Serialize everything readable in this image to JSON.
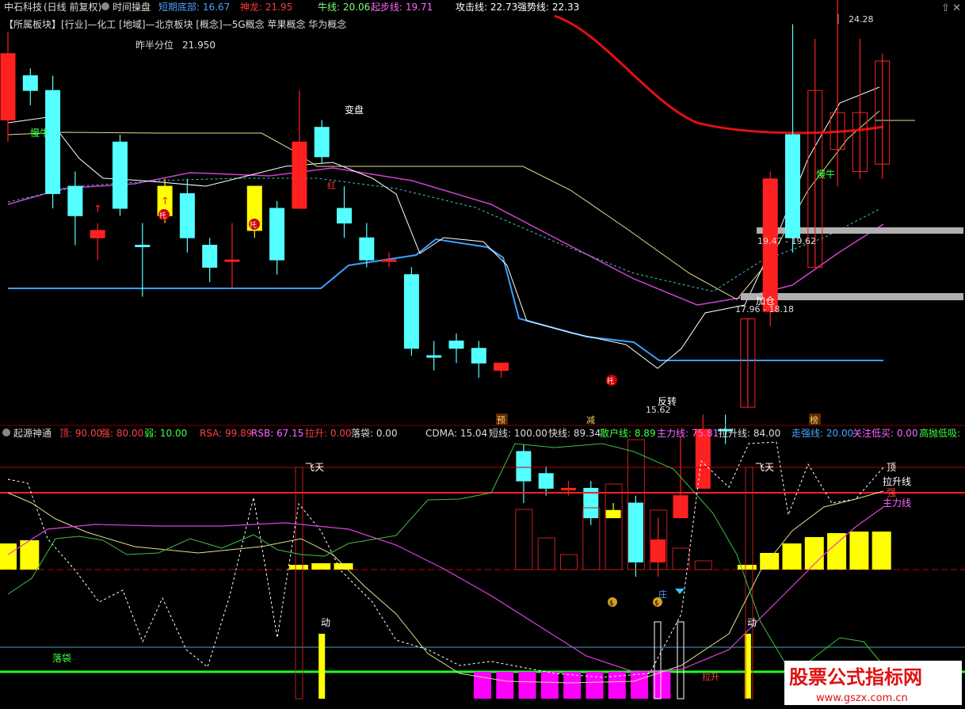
{
  "top_bar": {
    "stock": "中石科技",
    "mode": "(日线 前复权)",
    "panel_name": "时间操盘",
    "fields": [
      {
        "label": "短期底部:",
        "value": "16.67",
        "color": "#4aa3ff"
      },
      {
        "label": "神龙:",
        "value": "21.95",
        "color": "#ff3b3b"
      },
      {
        "label": "牛线:",
        "value": "20.06",
        "color": "#7fff7f"
      },
      {
        "label": "起步线:",
        "value": "19.71",
        "color": "#ff66ff"
      },
      {
        "label": "攻击线:",
        "value": "22.73",
        "color": "#ffffff"
      },
      {
        "label": "强势线:",
        "value": "22.33",
        "color": "#ffffff"
      }
    ]
  },
  "sector_line": "【所属板块】[行业]—化工 [地域]—北京板块 [概念]—5G概念 苹果概念 华为概念",
  "prev_half": {
    "label": "昨半分位",
    "value": "21.950"
  },
  "sub_bar": {
    "panel_name": "起源神通",
    "fields": [
      {
        "label": "顶:",
        "value": "90.00",
        "color": "#ff4040"
      },
      {
        "label": "强:",
        "value": "80.00",
        "color": "#ff4040"
      },
      {
        "label": "弱:",
        "value": "10.00",
        "color": "#40ff40"
      },
      {
        "label": "RSA:",
        "value": "99.89",
        "color": "#ff4040"
      },
      {
        "label": "RSB:",
        "value": "67.15",
        "color": "#ff66ff"
      },
      {
        "label": "拉升:",
        "value": "0.00",
        "color": "#ff4040"
      },
      {
        "label": "落袋:",
        "value": "0.00",
        "color": "#dddddd"
      },
      {
        "label": "CDMA:",
        "value": "15.04",
        "color": "#dddddd"
      },
      {
        "label": "短线:",
        "value": "100.00",
        "color": "#dddddd"
      },
      {
        "label": "快线:",
        "value": "89.34",
        "color": "#dddddd"
      },
      {
        "label": "散户线:",
        "value": "8.89",
        "color": "#40ff40"
      },
      {
        "label": "主力线:",
        "value": "75.81",
        "color": "#ff66ff"
      },
      {
        "label": "拉升线:",
        "value": "84.00",
        "color": "#dddddd"
      },
      {
        "label": "走强线:",
        "value": "20.00",
        "color": "#4aa3ff"
      },
      {
        "label": "关注低买:",
        "value": "0.00",
        "color": "#ff66ff"
      },
      {
        "label": "高抛低吸:",
        "value": "",
        "color": "#40ff40"
      }
    ]
  },
  "main_labels": {
    "bianpan": "变盘",
    "mangniu_left": "慢牛",
    "mangniu_right": "慢牛",
    "hong": "红",
    "fanzhuan": "反转",
    "jiacang": "加仓",
    "tuo": "托",
    "high_label": "24.28",
    "low_label": "15.62",
    "zone_upper": "19.47 - 19.62",
    "zone_lower": "17.96 - 18.18"
  },
  "marker_labels": {
    "yu": "预",
    "jian": "减",
    "bang": "榜"
  },
  "sub_labels": {
    "feitian": "飞天",
    "dong": "动",
    "luodai": "落袋",
    "lasheng": "拉升",
    "ding": "顶",
    "qiang": "强",
    "lashengxian": "拉升线",
    "zhulixian": "主力线",
    "zhuang": "庄"
  },
  "watermark": {
    "cn": "股票公式指标网",
    "url": "www.gszx.com.cn"
  },
  "colors": {
    "up": "#ff2020",
    "down": "#54ffff",
    "yellow": "#ffff00",
    "magenta": "#ff00ff",
    "grid_red": "#c00000"
  },
  "chart_data": {
    "type": "candlestick",
    "candles": [
      {
        "o": 21.2,
        "c": 22.1,
        "h": 22.4,
        "l": 20.9
      },
      {
        "o": 21.8,
        "c": 21.6,
        "h": 21.9,
        "l": 21.4
      },
      {
        "o": 21.6,
        "c": 20.2,
        "h": 21.8,
        "l": 20.0
      },
      {
        "o": 20.3,
        "c": 19.9,
        "h": 20.5,
        "l": 19.5
      },
      {
        "o": 19.7,
        "c": 19.6,
        "h": 19.8,
        "l": 19.3
      },
      {
        "o": 20.9,
        "c": 20.0,
        "h": 21.0,
        "l": 19.9
      },
      {
        "o": 19.5,
        "c": 19.5,
        "h": 19.8,
        "l": 18.8
      },
      {
        "o": 20.3,
        "c": 19.9,
        "h": 20.4,
        "l": 19.8
      },
      {
        "o": 20.2,
        "c": 19.6,
        "h": 20.4,
        "l": 19.4
      },
      {
        "o": 19.5,
        "c": 19.2,
        "h": 19.6,
        "l": 19.0
      },
      {
        "o": 19.3,
        "c": 19.3,
        "h": 19.8,
        "l": 18.9
      },
      {
        "o": 20.3,
        "c": 19.7,
        "h": 20.3,
        "l": 19.6
      },
      {
        "o": 20.0,
        "c": 19.3,
        "h": 20.1,
        "l": 19.1
      },
      {
        "o": 20.0,
        "c": 20.9,
        "h": 21.6,
        "l": 20.0
      },
      {
        "o": 21.1,
        "c": 20.7,
        "h": 21.2,
        "l": 20.6
      },
      {
        "o": 20.0,
        "c": 19.8,
        "h": 20.3,
        "l": 19.6
      },
      {
        "o": 19.6,
        "c": 19.3,
        "h": 19.8,
        "l": 19.2
      },
      {
        "o": 19.3,
        "c": 19.3,
        "h": 19.4,
        "l": 19.2
      },
      {
        "o": 19.1,
        "c": 18.1,
        "h": 19.2,
        "l": 18.0
      },
      {
        "o": 18.0,
        "c": 18.0,
        "h": 18.2,
        "l": 17.8
      },
      {
        "o": 18.2,
        "c": 18.1,
        "h": 18.3,
        "l": 17.9
      },
      {
        "o": 18.1,
        "c": 17.9,
        "h": 18.2,
        "l": 17.7
      },
      {
        "o": 17.8,
        "c": 17.9,
        "h": 17.9,
        "l": 17.7
      },
      {
        "o": 16.7,
        "c": 16.3,
        "h": 16.8,
        "l": 16.0
      },
      {
        "o": 16.4,
        "c": 16.2,
        "h": 16.5,
        "l": 16.1
      },
      {
        "o": 16.2,
        "c": 16.2,
        "h": 16.3,
        "l": 16.1
      },
      {
        "o": 16.2,
        "c": 15.8,
        "h": 16.3,
        "l": 15.7
      },
      {
        "o": 15.9,
        "c": 15.8,
        "h": 16.0,
        "l": 15.8
      },
      {
        "o": 16.0,
        "c": 15.2,
        "h": 16.1,
        "l": 15.0
      },
      {
        "o": 15.2,
        "c": 15.5,
        "h": 15.8,
        "l": 15.0
      },
      {
        "o": 15.8,
        "c": 16.1,
        "h": 16.9,
        "l": 15.8
      },
      {
        "o": 16.2,
        "c": 17.0,
        "h": 17.2,
        "l": 16.2
      },
      {
        "o": 17.0,
        "c": 17.0,
        "h": 17.2,
        "l": 16.8
      },
      {
        "o": 17.3,
        "c": 18.5,
        "h": 18.5,
        "l": 17.3
      },
      {
        "o": 18.6,
        "c": 20.4,
        "h": 20.5,
        "l": 18.4
      },
      {
        "o": 19.6,
        "c": 21.0,
        "h": 22.5,
        "l": 19.4
      },
      {
        "o": 19.2,
        "c": 21.6,
        "h": 22.3,
        "l": 19.2
      },
      {
        "o": 20.8,
        "c": 21.3,
        "h": 24.3,
        "l": 20.3
      },
      {
        "o": 20.5,
        "c": 21.3,
        "h": 22.3,
        "l": 20.4
      },
      {
        "o": 20.6,
        "c": 22.0,
        "h": 22.1,
        "l": 20.4
      }
    ],
    "candle_colors": [
      "up",
      "down",
      "down",
      "down",
      "up",
      "down",
      "flat",
      "yellow",
      "down",
      "down",
      "red-cross",
      "yellow",
      "down",
      "up",
      "down",
      "down",
      "down",
      "up",
      "down",
      "down",
      "down",
      "down",
      "up",
      "down",
      "down",
      "up",
      "down",
      "yellow",
      "down",
      "up",
      "up",
      "up",
      "flat",
      "up",
      "up",
      "down",
      "up",
      "up",
      "up",
      "up"
    ],
    "sub_yellow_bars": [
      {
        "i": 0,
        "v": 33
      },
      {
        "i": 1,
        "v": 37
      },
      {
        "i": 13,
        "v": 6
      },
      {
        "i": 14,
        "v": 8
      },
      {
        "i": 15,
        "v": 8
      },
      {
        "i": 33,
        "v": 6
      },
      {
        "i": 34,
        "v": 21
      },
      {
        "i": 35,
        "v": 33
      },
      {
        "i": 36,
        "v": 41
      },
      {
        "i": 37,
        "v": 46
      },
      {
        "i": 38,
        "v": 48
      },
      {
        "i": 39,
        "v": 48
      }
    ],
    "sub_red_bars": [
      {
        "i": 23,
        "v": 76
      },
      {
        "i": 24,
        "v": 40
      },
      {
        "i": 25,
        "v": 19
      },
      {
        "i": 26,
        "v": 78
      },
      {
        "i": 27,
        "v": 108
      },
      {
        "i": 28,
        "v": 164
      },
      {
        "i": 29,
        "v": 75
      },
      {
        "i": 30,
        "v": 27
      },
      {
        "i": 31,
        "v": 11
      }
    ],
    "sub_magenta_bars": [
      21,
      22,
      23,
      24,
      25,
      26,
      27,
      28,
      29
    ],
    "sub_dong": [
      14,
      33
    ]
  }
}
